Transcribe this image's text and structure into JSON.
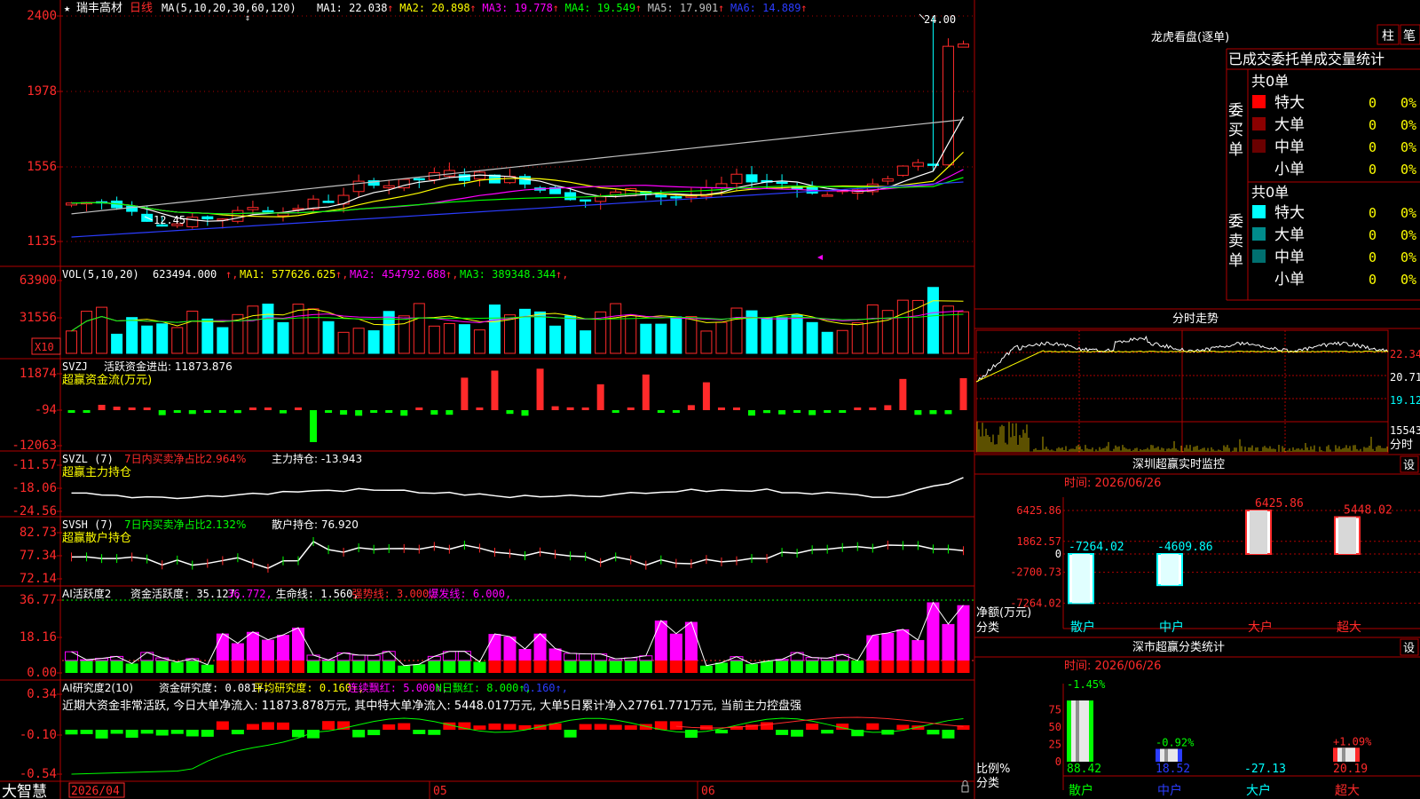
{
  "colors": {
    "bg": "#000000",
    "frame": "#b00000",
    "up": "#ff2a2a",
    "down": "#00ffff",
    "green": "#00ff00",
    "yellow": "#ffff00",
    "magenta": "#ff00ff",
    "white": "#ffffff",
    "gray": "#c0c0c0",
    "blue": "#2b3cff"
  },
  "price_panel": {
    "star": "★",
    "stock_name": "瑞丰高材",
    "period": "日线",
    "ma_header": "MA(5,10,20,30,60,120)",
    "ma_items": [
      {
        "label": "MA1: 22.038",
        "arrow": "↑",
        "color": "#ffffff"
      },
      {
        "label": "MA2: 20.898",
        "arrow": "↑",
        "color": "#ffff00"
      },
      {
        "label": "MA3: 19.778",
        "arrow": "↑",
        "color": "#ff00ff"
      },
      {
        "label": "MA4: 19.549",
        "arrow": "↑",
        "color": "#00ff00"
      },
      {
        "label": "MA5: 17.901",
        "arrow": "↑",
        "color": "#c0c0c0"
      },
      {
        "label": "MA6: 14.889",
        "arrow": "↑",
        "color": "#2b3cff"
      }
    ],
    "y_ticks": [
      "2400",
      "1978",
      "1556",
      "1135"
    ],
    "high_label": "24.00",
    "low_label": "12.45"
  },
  "vol_panel": {
    "header": "VOL(5,10,20)",
    "value": "623494.000",
    "items": [
      {
        "label": "MA1: 577626.625",
        "color": "#ffff00"
      },
      {
        "label": "MA2: 454792.688",
        "color": "#ff00ff"
      },
      {
        "label": "MA3: 389348.344",
        "color": "#00ff00"
      }
    ],
    "y_ticks": [
      "63900",
      "31556"
    ],
    "unit": "X10"
  },
  "svzj_panel": {
    "line1_code": "SVZJ",
    "line1_text": "活跃资金进出: 11873.876",
    "line2": "超赢资金流(万元)",
    "y_ticks": [
      "11874",
      "-94",
      "-12063"
    ]
  },
  "svzl_panel": {
    "code": "SVZL (7)",
    "ratio": "7日内买卖净占比2.964%",
    "holding": "主力持仓: -13.943",
    "line2": "超赢主力持仓",
    "y_ticks": [
      "-11.57",
      "-18.06",
      "-24.56"
    ]
  },
  "svsh_panel": {
    "code": "SVSH (7)",
    "ratio": "7日内买卖净占比2.132%",
    "holding": "散户持仓: 76.920",
    "arrow": "↓",
    "line2": "超赢散户持仓",
    "y_ticks": [
      "82.73",
      "77.34",
      "72.14"
    ]
  },
  "ai_active_panel": {
    "header": "AI活跃度2",
    "items": [
      {
        "label": "资金活跃度: 35.127",
        "color": "#ffffff"
      },
      {
        "label": "36.772",
        "color": "#ff00ff"
      },
      {
        "label": "生命线: 1.560",
        "color": "#ffffff"
      },
      {
        "label": "强势线: 3.000",
        "color": "#ff2a2a"
      },
      {
        "label": "爆发线: 6.000",
        "color": "#ff00ff"
      }
    ],
    "y_ticks": [
      "36.77",
      "18.16",
      "0.00"
    ]
  },
  "ai_research_panel": {
    "header": "AI研究度2(10)",
    "items": [
      {
        "label": "资金研究度: 0.081",
        "color": "#ffffff"
      },
      {
        "label": "平均研究度: 0.160",
        "color": "#ffff00"
      },
      {
        "label": "连续飘红: 5.000",
        "color": "#ff00ff"
      },
      {
        "label": "N日飘红: 8.000",
        "color": "#00ff00"
      },
      {
        "label": "0.160",
        "color": "#2b3cff"
      }
    ],
    "comment": "近期大资金非常活跃, 今日大单净流入: 11873.878万元, 其中特大单净流入: 5448.017万元, 大单5日累计净入27761.771万元, 当前主力控盘强",
    "y_ticks": [
      "0.34",
      "-0.10",
      "-0.54"
    ]
  },
  "bottom_bar": {
    "brand": "大智慧",
    "date_label": "2026/04",
    "months": [
      "05",
      "06"
    ]
  },
  "right_panel": {
    "title": "龙虎看盘(逐单)",
    "btn_bar": "柱",
    "btn_pen": "笔",
    "tabs": [
      "已成交",
      "委托单",
      "成交量统计"
    ],
    "buy_label": "委买单",
    "sell_label": "委卖单",
    "buy_total": "共0单",
    "sell_total": "共0单",
    "buy_rows": [
      {
        "name": "特大",
        "count": "0",
        "pct": "0%",
        "color": "#ff0000"
      },
      {
        "name": "大单",
        "count": "0",
        "pct": "0%",
        "color": "#8b0000"
      },
      {
        "name": "中单",
        "count": "0",
        "pct": "0%",
        "color": "#6a0000"
      },
      {
        "name": "小单",
        "count": "0",
        "pct": "0%",
        "color": ""
      }
    ],
    "sell_rows": [
      {
        "name": "特大",
        "count": "0",
        "pct": "0%",
        "color": "#00ffff"
      },
      {
        "name": "大单",
        "count": "0",
        "pct": "0%",
        "color": "#008b8b"
      },
      {
        "name": "中单",
        "count": "0",
        "pct": "0%",
        "color": "#007070"
      },
      {
        "name": "小单",
        "count": "0",
        "pct": "0%",
        "color": ""
      }
    ],
    "intraday_title": "分时走势",
    "intraday_ticks": [
      "22.34",
      "20.71",
      "19.12"
    ],
    "intraday_vol_tick": "15543",
    "intraday_unit": "分时",
    "monitor_title": "深圳超赢实时监控",
    "monitor_set": "设",
    "monitor_time": "时间: 2026/06/26",
    "monitor_y_ticks": [
      "6425.86",
      "1862.57",
      "0",
      "-2700.73",
      "-7264.02"
    ],
    "monitor_bars": [
      {
        "label": "散户",
        "value": -7264.02,
        "value_text": "-7264.02",
        "color": "#00ffff"
      },
      {
        "label": "中户",
        "value": -4609.86,
        "value_text": "-4609.86",
        "color": "#00ffff"
      },
      {
        "label": "大户",
        "value": 6425.86,
        "value_text": "6425.86",
        "color": "#ff2a2a"
      },
      {
        "label": "超大",
        "value": 5448.02,
        "value_text": "5448.02",
        "color": "#ff2a2a"
      }
    ],
    "monitor_axis_label_1": "净额(万元)",
    "monitor_axis_label_2": "分类",
    "class_title": "深市超赢分类统计",
    "class_set": "设",
    "class_time": "时间: 2026/06/26",
    "class_y_ticks": [
      "75",
      "50",
      "25",
      "0"
    ],
    "class_bars": [
      {
        "label": "散户",
        "top": "-1.45%",
        "bottom": "88.42",
        "top_color": "#00ff00",
        "bottom_color": "#00ff00",
        "ratio": 88.42,
        "bar_color": "#00ff00"
      },
      {
        "label": "中户",
        "top": "-0.92%",
        "bottom": "18.52",
        "top_color": "#00ff00",
        "bottom_color": "#2b3cff",
        "ratio": 18.52,
        "bar_color": "#2b3cff"
      },
      {
        "label": "大户",
        "top": "",
        "bottom": "-27.13",
        "top_color": "#00ffff",
        "bottom_color": "#00ffff",
        "ratio": 0,
        "bar_color": "#00ffff"
      },
      {
        "label": "超大",
        "top": "+1.09%",
        "bottom": "20.19",
        "top_color": "#ff2a2a",
        "bottom_color": "#ff2a2a",
        "ratio": 20.19,
        "bar_color": "#ff2a2a"
      }
    ],
    "class_axis_label_1": "比例%",
    "class_axis_label_2": "分类"
  }
}
